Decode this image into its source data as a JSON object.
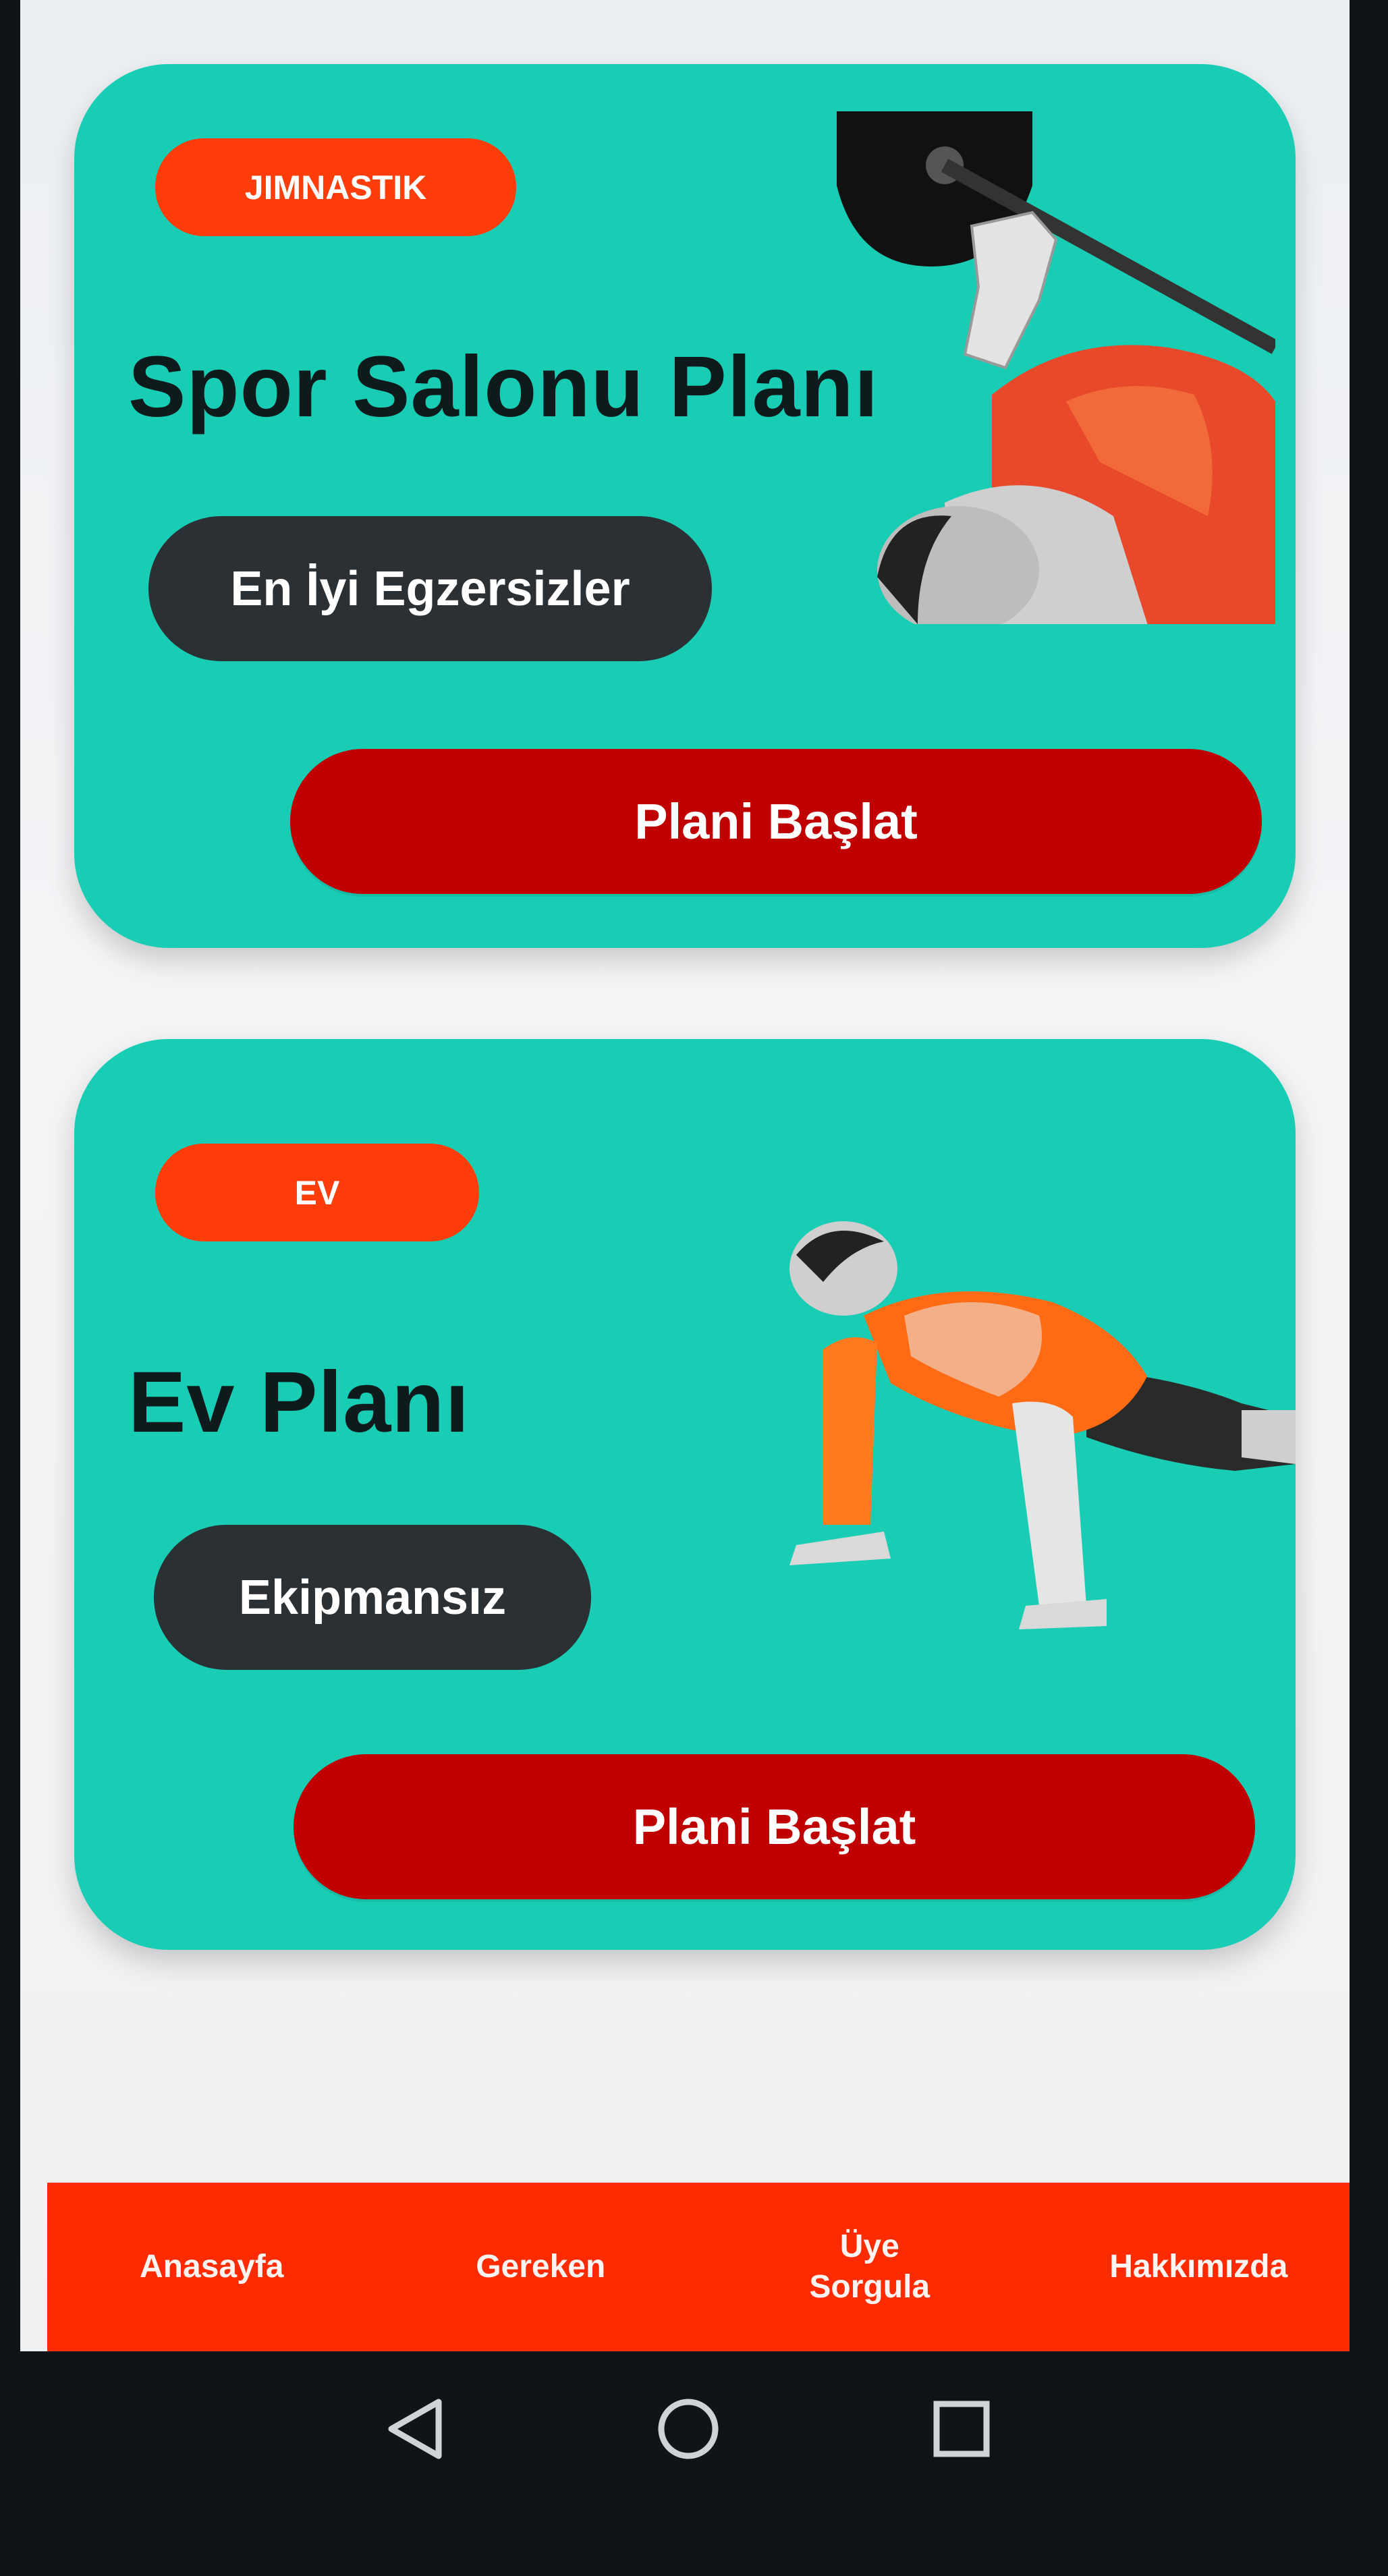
{
  "cards": [
    {
      "tag": "JIMNASTIK",
      "title": "Spor Salonu Planı",
      "pill": "En İyi Egzersizler",
      "cta": "Plani Başlat",
      "illustration": "barbell-press-muscle-figure"
    },
    {
      "tag": "EV",
      "title": "Ev Planı",
      "pill": "Ekipmansız",
      "cta": "Plani Başlat",
      "illustration": "push-up-muscle-figure"
    }
  ],
  "tabbar": {
    "items": [
      {
        "label": "Anasayfa"
      },
      {
        "label": "Gereken"
      },
      {
        "label": "Üye\nSorgula"
      },
      {
        "label": "Hakkımızda"
      }
    ]
  },
  "navbar": {
    "back_icon": "triangle-back-icon",
    "home_icon": "circle-home-icon",
    "recent_icon": "square-recents-icon"
  },
  "colors": {
    "card_bg": "#19cdb5",
    "tag_bg": "#ff3d0a",
    "pill_bg": "#2b3035",
    "cta_bg": "#c00000",
    "tabbar_bg": "#ff2b00"
  }
}
